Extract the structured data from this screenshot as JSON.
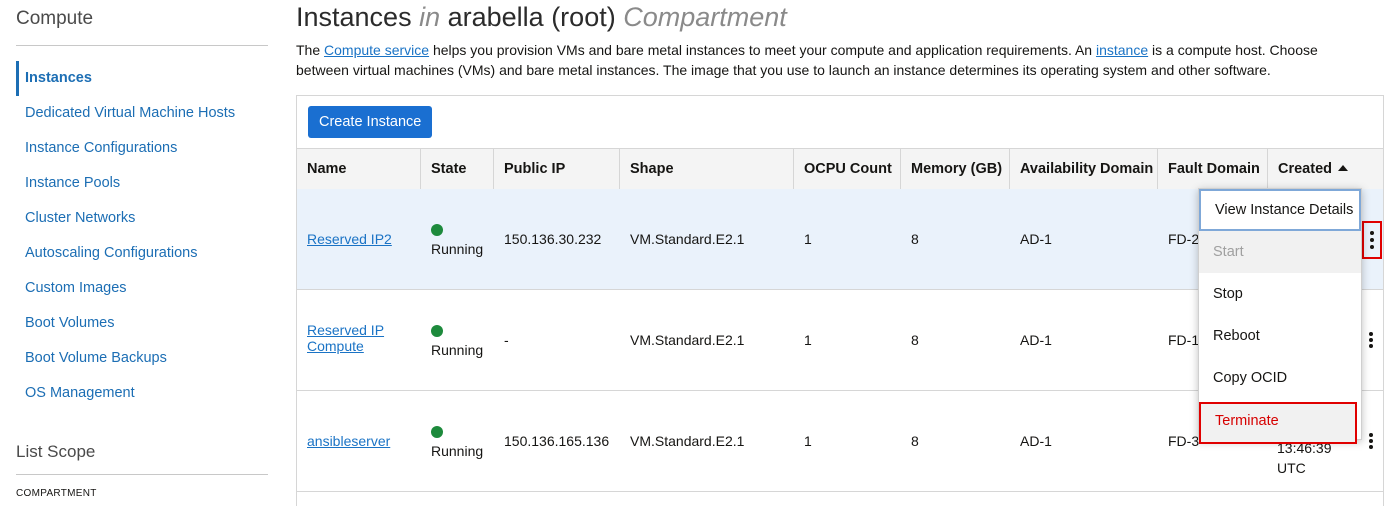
{
  "sidebar": {
    "title": "Compute",
    "items": [
      {
        "label": "Instances"
      },
      {
        "label": "Dedicated Virtual Machine Hosts"
      },
      {
        "label": "Instance Configurations"
      },
      {
        "label": "Instance Pools"
      },
      {
        "label": "Cluster Networks"
      },
      {
        "label": "Autoscaling Configurations"
      },
      {
        "label": "Custom Images"
      },
      {
        "label": "Boot Volumes"
      },
      {
        "label": "Boot Volume Backups"
      },
      {
        "label": "OS Management"
      }
    ],
    "scope_title": "List Scope",
    "compartment_label": "COMPARTMENT"
  },
  "header": {
    "title_main": "Instances",
    "title_in": "in",
    "title_compartment": "arabella (root)",
    "title_suffix": "Compartment"
  },
  "description": {
    "p1": "The ",
    "link1": "Compute service",
    "p2": " helps you provision VMs and bare metal instances to meet your compute and application requirements. An ",
    "link2": "instance",
    "p3": " is a compute host. Choose between virtual machines (VMs) and bare metal instances. The image that you use to launch an instance determines its operating system and other software."
  },
  "toolbar": {
    "create_label": "Create Instance"
  },
  "table": {
    "columns": [
      "Name",
      "State",
      "Public IP",
      "Shape",
      "OCPU Count",
      "Memory (GB)",
      "Availability Domain",
      "Fault Domain",
      "Created"
    ],
    "rows": [
      {
        "name": "Reserved IP2",
        "state": "Running",
        "public_ip": "150.136.30.232",
        "shape": "VM.Standard.E2.1",
        "ocpu": "1",
        "memory": "8",
        "ad": "AD-1",
        "fd": "FD-2"
      },
      {
        "name_line1": "Reserved IP",
        "name_line2": "Compute",
        "state": "Running",
        "public_ip": "-",
        "shape": "VM.Standard.E2.1",
        "ocpu": "1",
        "memory": "8",
        "ad": "AD-1",
        "fd": "FD-1"
      },
      {
        "name": "ansibleserver",
        "state": "Running",
        "public_ip": "150.136.165.136",
        "shape": "VM.Standard.E2.1",
        "ocpu": "1",
        "memory": "8",
        "ad": "AD-1",
        "fd": "FD-3",
        "created_time": "13:46:39",
        "created_tz": "UTC"
      }
    ]
  },
  "menu": {
    "items": [
      "View Instance Details",
      "Start",
      "Stop",
      "Reboot",
      "Copy OCID",
      "Terminate"
    ]
  },
  "colors": {
    "accent": "#1a6fd1",
    "running": "#1d8a3c",
    "danger": "#d60000"
  }
}
